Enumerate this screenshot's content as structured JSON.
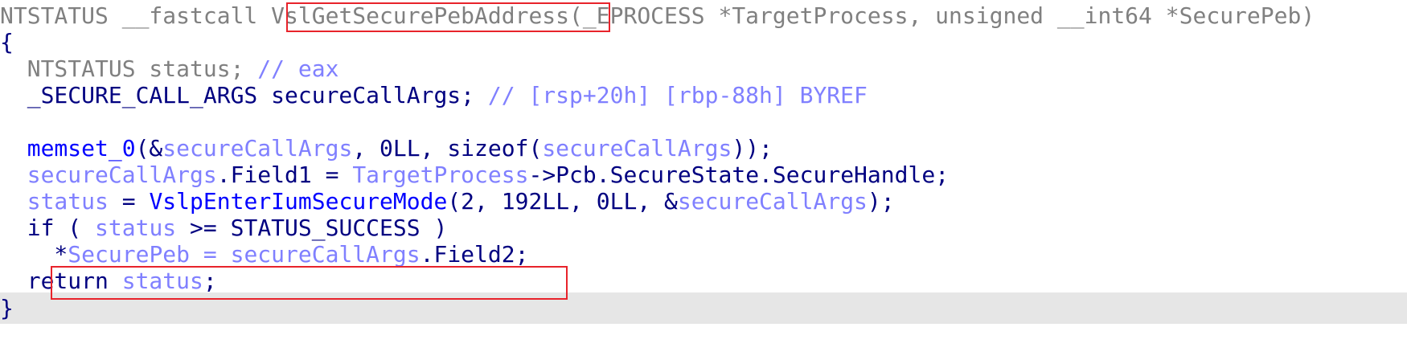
{
  "code": {
    "line1": {
      "t1": "NTSTATUS __fastcall ",
      "t2": "VslGetSecurePebAddress",
      "t3": "(_EPROCESS *TargetProcess, unsigned __int64 *SecurePeb)"
    },
    "line2": {
      "t1": "{"
    },
    "line3": {
      "t1": "  NTSTATUS status; ",
      "t2": "// eax"
    },
    "line4": {
      "t1": "  _SECURE_CALL_ARGS secureCallArgs; ",
      "t2": "// [rsp+20h] [rbp-88h] BYREF"
    },
    "line5": {
      "t1": ""
    },
    "line6": {
      "t1": "  ",
      "t2": "memset_0",
      "t3": "(&",
      "t4": "secureCallArgs",
      "t5": ", 0LL, sizeof(",
      "t6": "secureCallArgs",
      "t7": "));"
    },
    "line7": {
      "t1": "  ",
      "t2": "secureCallArgs",
      "t3": ".Field1 = ",
      "t4": "TargetProcess",
      "t5": "->Pcb.SecureState.SecureHandle;"
    },
    "line8": {
      "t1": "  ",
      "t2": "status",
      "t3": " = ",
      "t4": "VslpEnterIumSecureMode",
      "t5": "(2, 192LL, 0LL, &",
      "t6": "secureCallArgs",
      "t7": ");"
    },
    "line9": {
      "t1": "  if ( ",
      "t2": "status",
      "t3": " >= STATUS_SUCCESS )"
    },
    "line10": {
      "t1": "    *",
      "t2": "SecurePeb",
      "t3": " = ",
      "t4": "secureCallArgs",
      "t5": ".Field2;"
    },
    "line11": {
      "t1": "  return ",
      "t2": "status",
      "t3": ";"
    },
    "line12": {
      "t1": "}"
    }
  },
  "colors": {
    "plain": "#000080",
    "keyword_type": "#808080",
    "local_var": "#8080ff",
    "function": "#0000ff",
    "comment": "#8080ff",
    "current_line_bg": "#e6e6e6",
    "highlight_box": "#e8232b"
  }
}
